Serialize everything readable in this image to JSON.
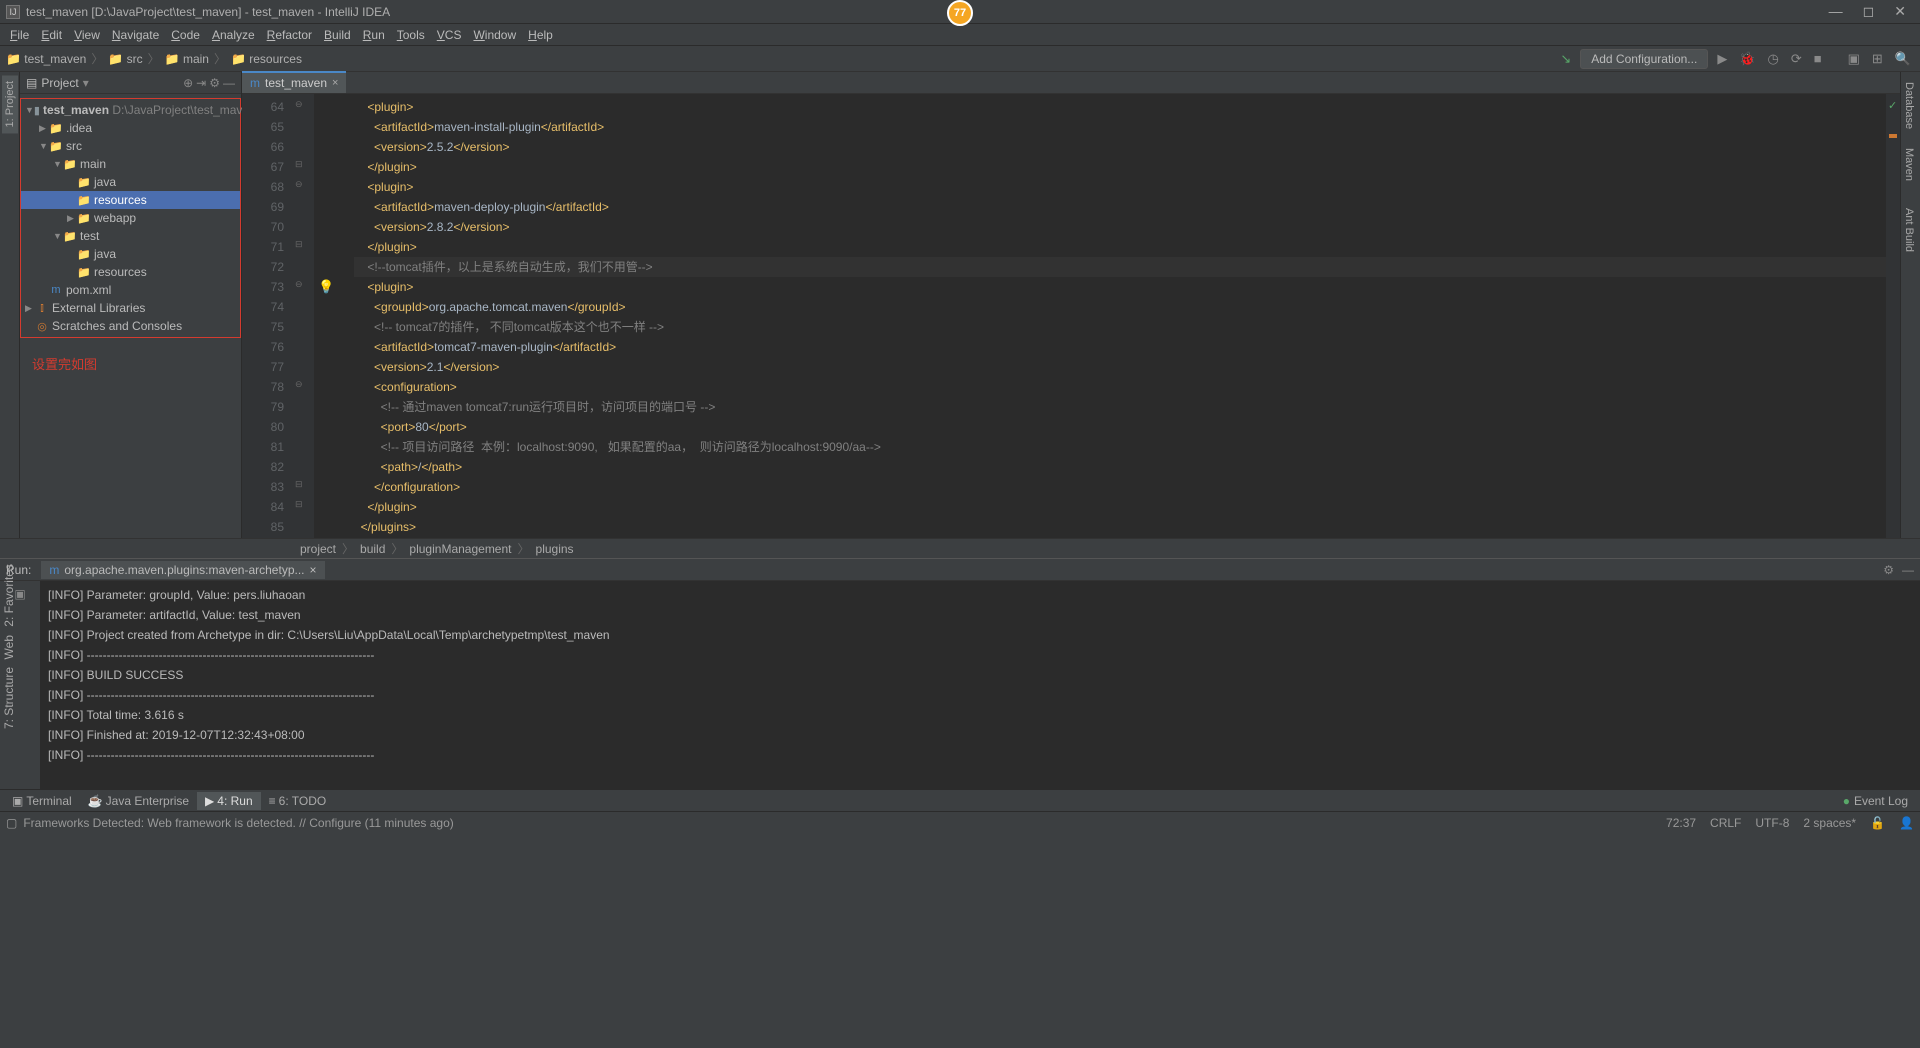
{
  "title": "test_maven [D:\\JavaProject\\test_maven] - test_maven - IntelliJ IDEA",
  "badge": "77",
  "menu": [
    "File",
    "Edit",
    "View",
    "Navigate",
    "Code",
    "Analyze",
    "Refactor",
    "Build",
    "Run",
    "Tools",
    "VCS",
    "Window",
    "Help"
  ],
  "breadcrumbs": [
    "test_maven",
    "src",
    "main",
    "resources"
  ],
  "addConfig": "Add Configuration...",
  "projectLabel": "Project",
  "tree": {
    "root": {
      "name": "test_maven",
      "path": "D:\\JavaProject\\test_maven"
    },
    "idea": ".idea",
    "src": "src",
    "main": "main",
    "java_main": "java",
    "resources_main": "resources",
    "webapp": "webapp",
    "test": "test",
    "java_test": "java",
    "resources_test": "resources",
    "pom": "pom.xml",
    "ext": "External Libraries",
    "scratches": "Scratches and Consoles"
  },
  "note": "设置完如图",
  "editorTab": "test_maven",
  "codeLines": [
    {
      "n": 64,
      "html": "<span class='tag'>&lt;plugin&gt;</span>",
      "indent": 2
    },
    {
      "n": 65,
      "html": "<span class='tag'>&lt;artifactId&gt;</span><span class='text'>maven-install-plugin</span><span class='tag'>&lt;/artifactId&gt;</span>",
      "indent": 3
    },
    {
      "n": 66,
      "html": "<span class='tag'>&lt;version&gt;</span><span class='text'>2.5.2</span><span class='tag'>&lt;/version&gt;</span>",
      "indent": 3
    },
    {
      "n": 67,
      "html": "<span class='tag'>&lt;/plugin&gt;</span>",
      "indent": 2
    },
    {
      "n": 68,
      "html": "<span class='tag'>&lt;plugin&gt;</span>",
      "indent": 2
    },
    {
      "n": 69,
      "html": "<span class='tag'>&lt;artifactId&gt;</span><span class='text'>maven-deploy-plugin</span><span class='tag'>&lt;/artifactId&gt;</span>",
      "indent": 3
    },
    {
      "n": 70,
      "html": "<span class='tag'>&lt;version&gt;</span><span class='text'>2.8.2</span><span class='tag'>&lt;/version&gt;</span>",
      "indent": 3
    },
    {
      "n": 71,
      "html": "<span class='tag'>&lt;/plugin&gt;</span>",
      "indent": 2
    },
    {
      "n": 72,
      "html": "<span class='comment'>&lt;!--tomcat插件，以上是系统自动生成，我们不用管--&gt;</span>",
      "indent": 2,
      "current": true
    },
    {
      "n": 73,
      "html": "<span class='tag'>&lt;plugin&gt;</span>",
      "indent": 2
    },
    {
      "n": 74,
      "html": "<span class='tag'>&lt;groupId&gt;</span><span class='text'>org.apache.tomcat.maven</span><span class='tag'>&lt;/groupId&gt;</span>",
      "indent": 3
    },
    {
      "n": 75,
      "html": "<span class='comment'>&lt;!-- tomcat7的插件， 不同tomcat版本这个也不一样 --&gt;</span>",
      "indent": 3
    },
    {
      "n": 76,
      "html": "<span class='tag'>&lt;artifactId&gt;</span><span class='text'>tomcat7-maven-plugin</span><span class='tag'>&lt;/artifactId&gt;</span>",
      "indent": 3
    },
    {
      "n": 77,
      "html": "<span class='tag'>&lt;version&gt;</span><span class='text'>2.1</span><span class='tag'>&lt;/version&gt;</span>",
      "indent": 3
    },
    {
      "n": 78,
      "html": "<span class='tag'>&lt;configuration&gt;</span>",
      "indent": 3
    },
    {
      "n": 79,
      "html": "<span class='comment'>&lt;!-- 通过maven tomcat7:run运行项目时，访问项目的端口号 --&gt;</span>",
      "indent": 4
    },
    {
      "n": 80,
      "html": "<span class='tag'>&lt;port&gt;</span><span class='text'>80</span><span class='tag'>&lt;/port&gt;</span>",
      "indent": 4
    },
    {
      "n": 81,
      "html": "<span class='comment'>&lt;!-- 项目访问路径  本例：localhost:9090,   如果配置的aa，  则访问路径为localhost:9090/aa--&gt;</span>",
      "indent": 4
    },
    {
      "n": 82,
      "html": "<span class='tag'>&lt;path&gt;</span><span class='text'>/</span><span class='tag'>&lt;/path&gt;</span>",
      "indent": 4
    },
    {
      "n": 83,
      "html": "<span class='tag'>&lt;/configuration&gt;</span>",
      "indent": 3
    },
    {
      "n": 84,
      "html": "<span class='tag'>&lt;/plugin&gt;</span>",
      "indent": 2
    },
    {
      "n": 85,
      "html": "<span class='tag'>&lt;/plugins&gt;</span>",
      "indent": 1
    }
  ],
  "editorCrumbs": [
    "project",
    "build",
    "pluginManagement",
    "plugins"
  ],
  "runLabel": "Run:",
  "runTab": "org.apache.maven.plugins:maven-archetyp...",
  "console": [
    "[INFO] Parameter: groupId, Value: pers.liuhaoan",
    "[INFO] Parameter: artifactId, Value: test_maven",
    "[INFO] Project created from Archetype in dir: C:\\Users\\Liu\\AppData\\Local\\Temp\\archetypetmp\\test_maven",
    "[INFO] ------------------------------------------------------------------------",
    "[INFO] BUILD SUCCESS",
    "[INFO] ------------------------------------------------------------------------",
    "[INFO] Total time:  3.616 s",
    "[INFO] Finished at: 2019-12-07T12:32:43+08:00",
    "[INFO] ------------------------------------------------------------------------"
  ],
  "bottomTabs": {
    "terminal": "Terminal",
    "javaee": "Java Enterprise",
    "run": "4: Run",
    "todo": "6: TODO"
  },
  "eventLog": "Event Log",
  "statusMsg": "Frameworks Detected: Web framework is detected. // Configure (11 minutes ago)",
  "statusRight": {
    "pos": "72:37",
    "eol": "CRLF",
    "enc": "UTF-8",
    "indent": "2 spaces*"
  },
  "rightTabs": {
    "db": "Database",
    "maven": "Maven",
    "ant": "Ant Build"
  },
  "sideTabs": {
    "project": "1: Project",
    "fav": "2: Favorites",
    "web": "Web",
    "struct": "7: Structure"
  }
}
